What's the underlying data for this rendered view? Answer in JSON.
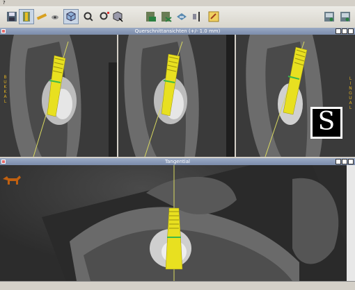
{
  "window": {
    "title": "?"
  },
  "toolbar": {
    "tools": [
      {
        "id": "save",
        "icon": "save-icon"
      },
      {
        "id": "implant",
        "icon": "implant-tool-icon"
      },
      {
        "id": "measure",
        "icon": "ruler-icon"
      },
      {
        "id": "eye",
        "icon": "eye-icon"
      },
      {
        "id": "move",
        "icon": "move-icon"
      },
      {
        "id": "rotate",
        "icon": "cube-rotate-icon"
      },
      {
        "id": "zoom",
        "icon": "zoom-icon"
      },
      {
        "id": "zoom-region",
        "icon": "zoom-region-icon"
      },
      {
        "id": "cube-select",
        "icon": "cube-select-icon"
      },
      {
        "id": "export",
        "icon": "export-icon"
      },
      {
        "id": "layers",
        "icon": "layers-icon"
      },
      {
        "id": "settings",
        "icon": "settings-icon"
      },
      {
        "id": "compare",
        "icon": "compare-icon"
      },
      {
        "id": "report",
        "icon": "report-icon"
      },
      {
        "id": "window-a",
        "icon": "window-a-icon"
      },
      {
        "id": "window-b",
        "icon": "window-b-icon"
      }
    ]
  },
  "cross_section": {
    "title": "Querschnittansichten (+/- 1.0 mm)",
    "left_label": "BUKKAL",
    "right_label": "LINGUAL",
    "logo_letter": "S"
  },
  "tangential": {
    "title": "Tangential"
  },
  "colors": {
    "implant": "#e8e020",
    "implant_ring": "#3ab84a",
    "guide_line": "#d8d860",
    "header": "#8898b8",
    "orientation_label": "#e0b020"
  }
}
